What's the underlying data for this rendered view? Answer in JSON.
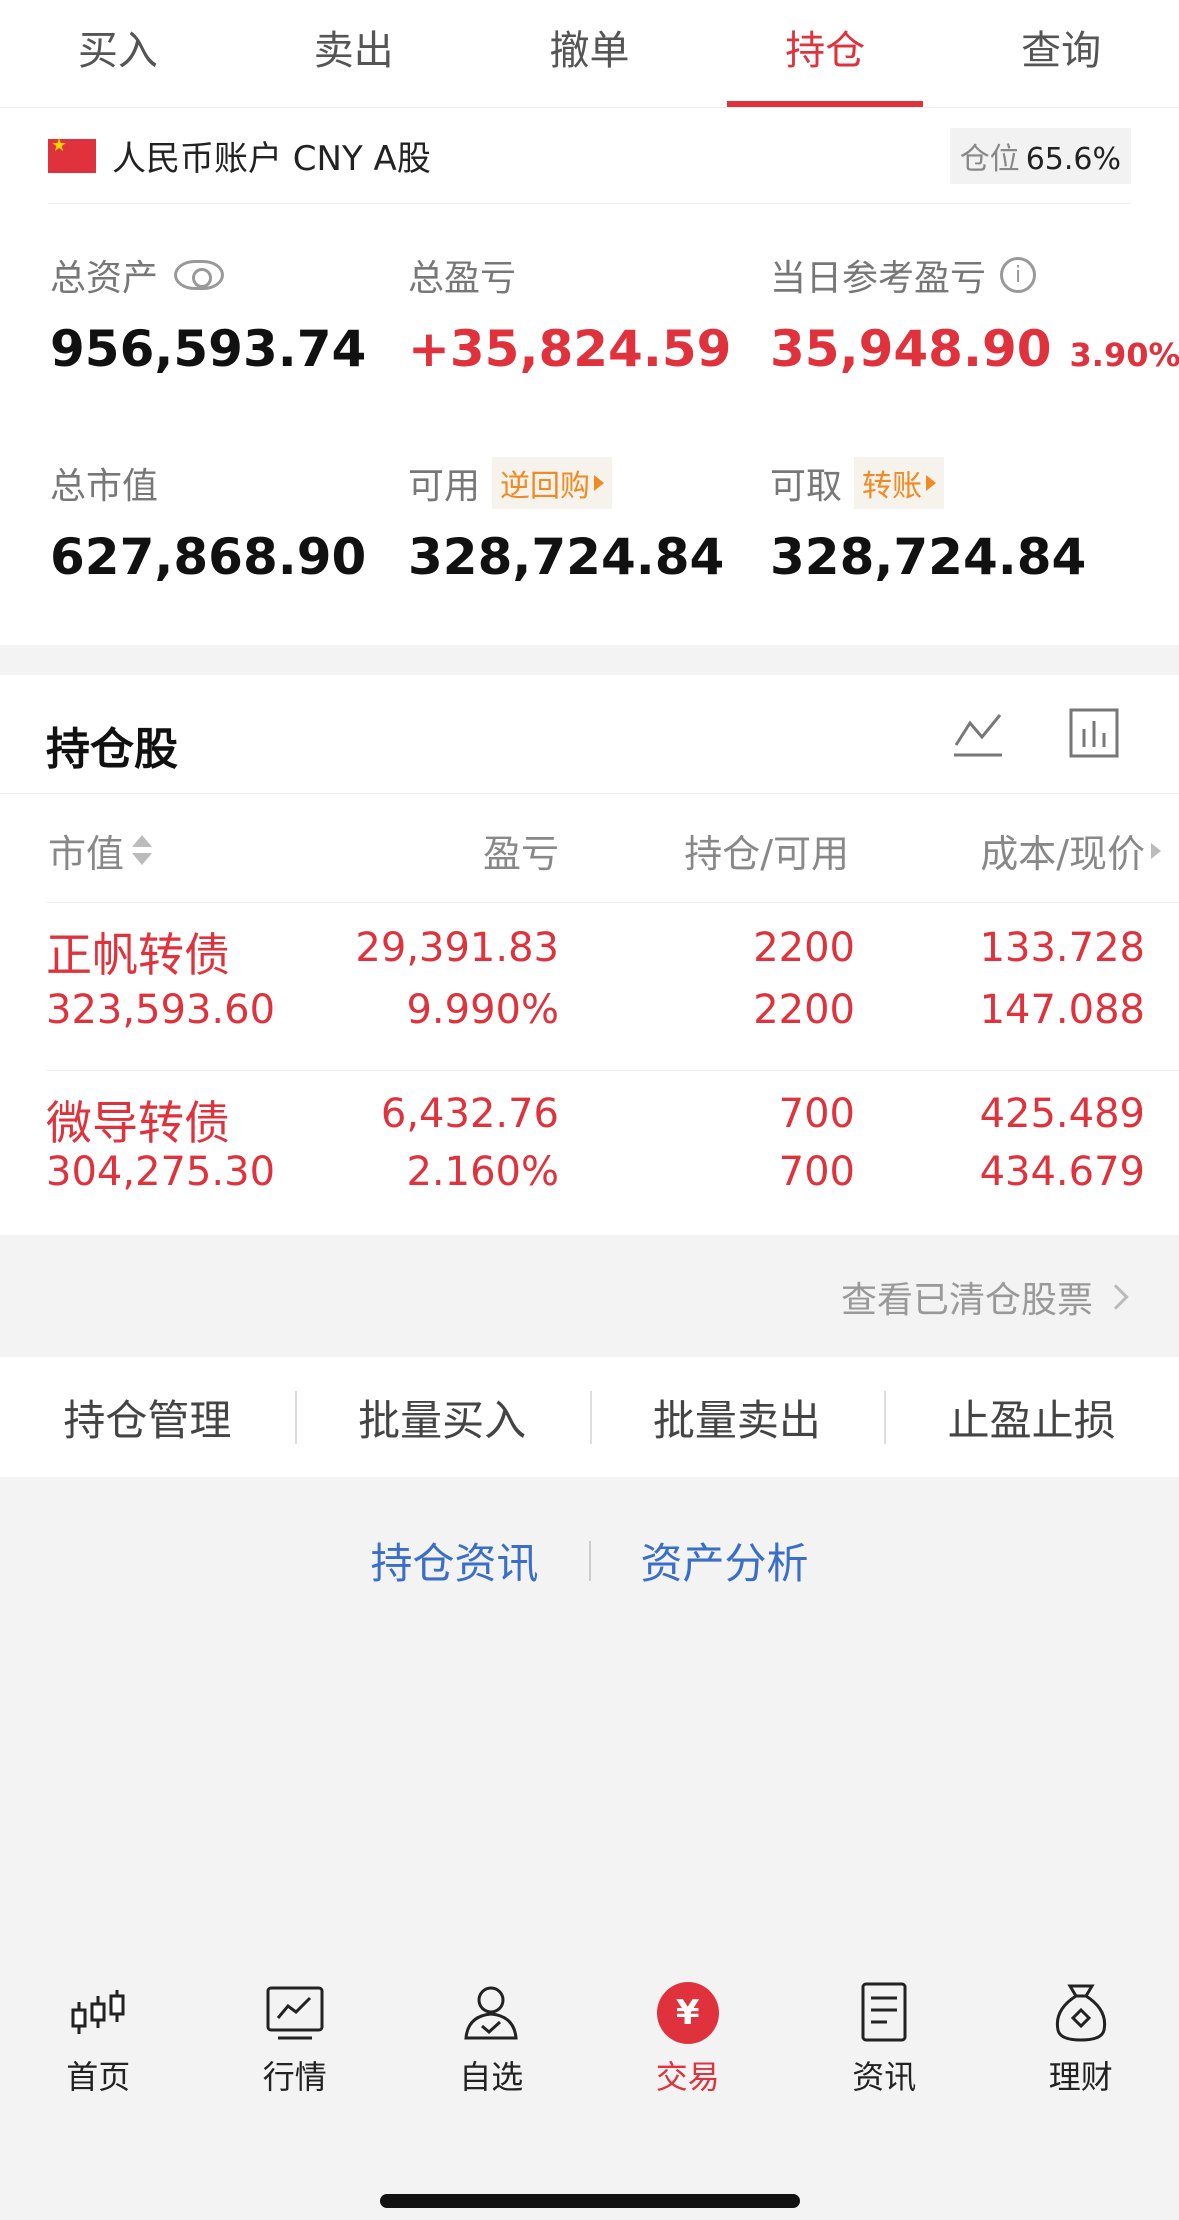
{
  "tabs": [
    {
      "label": "买入",
      "active": false
    },
    {
      "label": "卖出",
      "active": false
    },
    {
      "label": "撤单",
      "active": false
    },
    {
      "label": "持仓",
      "active": true
    },
    {
      "label": "查询",
      "active": false
    }
  ],
  "account": {
    "name": "人民币账户 CNY A股",
    "position_label": "仓位",
    "position_value": "65.6%",
    "total_assets_label": "总资产",
    "total_assets": "956,593.74",
    "total_pnl_label": "总盈亏",
    "total_pnl": "+35,824.59",
    "daily_pnl_label": "当日参考盈亏",
    "daily_pnl": "35,948.90",
    "daily_pnl_pct": "3.90%",
    "market_value_label": "总市值",
    "market_value": "627,868.90",
    "available_label": "可用",
    "reverse_repo": "逆回购",
    "available": "328,724.84",
    "withdrawable_label": "可取",
    "transfer": "转账",
    "withdrawable": "328,724.84"
  },
  "holdings": {
    "title": "持仓股",
    "columns": [
      "市值",
      "盈亏",
      "持仓/可用",
      "成本/现价"
    ],
    "rows": [
      {
        "name": "正帆转债",
        "market_value": "323,593.60",
        "pnl": "29,391.83",
        "pnl_pct": "9.990%",
        "holding": "2200",
        "available": "2200",
        "cost": "133.728",
        "price": "147.088"
      },
      {
        "name": "微导转债",
        "market_value": "304,275.30",
        "pnl": "6,432.76",
        "pnl_pct": "2.160%",
        "holding": "700",
        "available": "700",
        "cost": "425.489",
        "price": "434.679"
      }
    ]
  },
  "cleared_link": "查看已清仓股票",
  "actions": [
    "持仓管理",
    "批量买入",
    "批量卖出",
    "止盈止损"
  ],
  "links": [
    "持仓资讯",
    "资产分析"
  ],
  "nav": [
    {
      "label": "首页",
      "icon": "candlestick-icon"
    },
    {
      "label": "行情",
      "icon": "chart-icon"
    },
    {
      "label": "自选",
      "icon": "user-check-icon"
    },
    {
      "label": "交易",
      "icon": "yen-icon",
      "active": true
    },
    {
      "label": "资讯",
      "icon": "document-icon"
    },
    {
      "label": "理财",
      "icon": "money-bag-icon"
    }
  ],
  "colors": {
    "accent": "#e0323c",
    "link": "#3a6ec8",
    "chip": "#f08a24"
  }
}
